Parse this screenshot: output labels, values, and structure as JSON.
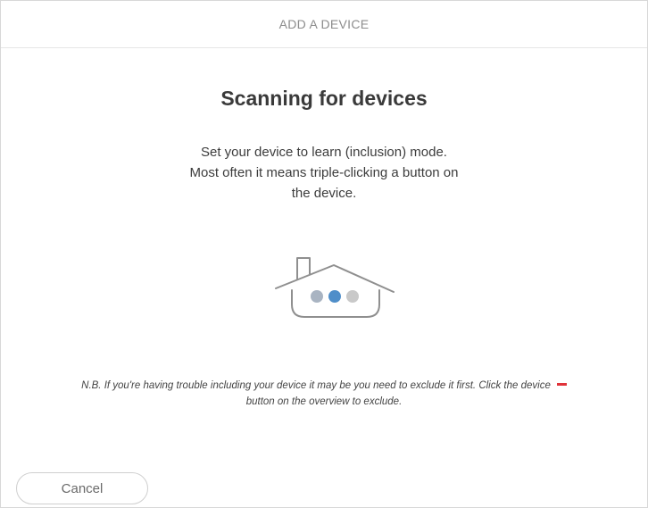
{
  "header": {
    "title": "ADD A DEVICE"
  },
  "main": {
    "title": "Scanning for devices",
    "instructions_line1": "Set your device to learn (inclusion) mode.",
    "instructions_line2": "Most often it means triple-clicking a button on",
    "instructions_line3": "the device.",
    "illustration": {
      "icon": "house-scanning-icon",
      "dots": [
        {
          "color": "#a9b4c2"
        },
        {
          "color": "#4f8ec9"
        },
        {
          "color": "#c9c9c9"
        }
      ]
    },
    "note_line1": "N.B. If you're having trouble including your device it may be you need to exclude it first. Click the device",
    "note_icon": "minus-icon",
    "note_line2": "button on the overview to exclude."
  },
  "footer": {
    "cancel_label": "Cancel"
  },
  "colors": {
    "accent_red": "#e0333a",
    "active_dot": "#4f8ec9"
  }
}
